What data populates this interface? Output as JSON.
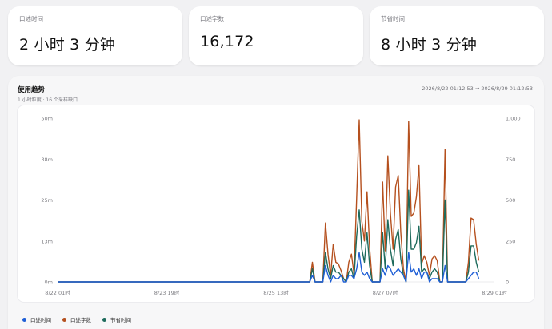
{
  "cards": [
    {
      "label": "口述时间",
      "value": "2 小时 3 分钟"
    },
    {
      "label": "口述字数",
      "value": "16,172"
    },
    {
      "label": "节省时间",
      "value": "8 小时 3 分钟"
    }
  ],
  "panel": {
    "title": "使用趋势",
    "subtitle": "1 小时粒度 · 16 个采样缺口",
    "range": "2026/8/22 01:12:53 → 2026/8/29 01:12:53"
  },
  "colors": {
    "dictation_time": "#1f5fd6",
    "word_count": "#b5501e",
    "saved_time": "#1e6b5c"
  },
  "chart_data": {
    "type": "line",
    "x_tick_labels": [
      "8/22 01时",
      "8/23 19时",
      "8/25 13时",
      "8/27 07时",
      "8/29 01时"
    ],
    "x_tick_positions": [
      0,
      42,
      84,
      126,
      168
    ],
    "x_range": [
      0,
      168
    ],
    "left_axis": {
      "ticks": [
        "0m",
        "13m",
        "25m",
        "38m",
        "50m"
      ],
      "ylim": [
        0,
        50
      ]
    },
    "right_axis": {
      "ticks": [
        "0",
        "250",
        "500",
        "750",
        "1,000"
      ],
      "ylim": [
        0,
        1000
      ]
    },
    "grid": false,
    "legend_position": "bottom-left",
    "series": [
      {
        "name": "口述时间",
        "axis": "left",
        "color": "#1f5fd6",
        "points": [
          [
            0,
            0
          ],
          [
            97,
            0
          ],
          [
            98,
            2
          ],
          [
            99,
            0
          ],
          [
            100,
            0
          ],
          [
            101,
            0
          ],
          [
            102,
            0
          ],
          [
            103,
            5
          ],
          [
            104,
            2
          ],
          [
            105,
            0
          ],
          [
            106,
            2
          ],
          [
            107,
            1
          ],
          [
            108,
            1
          ],
          [
            109,
            2
          ],
          [
            110,
            0
          ],
          [
            111,
            0
          ],
          [
            112,
            2
          ],
          [
            113,
            2
          ],
          [
            114,
            1
          ],
          [
            115,
            4
          ],
          [
            116,
            9
          ],
          [
            117,
            3
          ],
          [
            118,
            2
          ],
          [
            119,
            3
          ],
          [
            120,
            1
          ],
          [
            121,
            0
          ],
          [
            122,
            0
          ],
          [
            123,
            0
          ],
          [
            124,
            0
          ],
          [
            125,
            4
          ],
          [
            126,
            2
          ],
          [
            127,
            5
          ],
          [
            128,
            4
          ],
          [
            129,
            2
          ],
          [
            130,
            3
          ],
          [
            131,
            4
          ],
          [
            132,
            3
          ],
          [
            133,
            2
          ],
          [
            134,
            0
          ],
          [
            135,
            9
          ],
          [
            136,
            3
          ],
          [
            137,
            4
          ],
          [
            138,
            2
          ],
          [
            139,
            4
          ],
          [
            140,
            1
          ],
          [
            141,
            3
          ],
          [
            142,
            3
          ],
          [
            143,
            0
          ],
          [
            144,
            1
          ],
          [
            145,
            1
          ],
          [
            146,
            1
          ],
          [
            147,
            0
          ],
          [
            148,
            0
          ],
          [
            149,
            5
          ],
          [
            150,
            0
          ],
          [
            151,
            0
          ],
          [
            152,
            0
          ],
          [
            153,
            0
          ],
          [
            154,
            0
          ],
          [
            155,
            0
          ],
          [
            156,
            0
          ],
          [
            157,
            0
          ],
          [
            158,
            1
          ],
          [
            159,
            2
          ],
          [
            160,
            3
          ],
          [
            161,
            3
          ],
          [
            162,
            1
          ]
        ]
      },
      {
        "name": "口述字数",
        "axis": "right",
        "color": "#b5501e",
        "points": [
          [
            0,
            0
          ],
          [
            97,
            0
          ],
          [
            98,
            120
          ],
          [
            99,
            0
          ],
          [
            100,
            0
          ],
          [
            101,
            0
          ],
          [
            102,
            0
          ],
          [
            103,
            360
          ],
          [
            104,
            170
          ],
          [
            105,
            40
          ],
          [
            106,
            230
          ],
          [
            107,
            120
          ],
          [
            108,
            110
          ],
          [
            109,
            70
          ],
          [
            110,
            20
          ],
          [
            111,
            0
          ],
          [
            112,
            120
          ],
          [
            113,
            170
          ],
          [
            114,
            50
          ],
          [
            115,
            510
          ],
          [
            116,
            990
          ],
          [
            117,
            370
          ],
          [
            118,
            250
          ],
          [
            119,
            550
          ],
          [
            120,
            210
          ],
          [
            121,
            0
          ],
          [
            122,
            0
          ],
          [
            123,
            0
          ],
          [
            124,
            0
          ],
          [
            125,
            610
          ],
          [
            126,
            190
          ],
          [
            127,
            770
          ],
          [
            128,
            420
          ],
          [
            129,
            200
          ],
          [
            130,
            580
          ],
          [
            131,
            650
          ],
          [
            132,
            300
          ],
          [
            133,
            80
          ],
          [
            134,
            0
          ],
          [
            135,
            980
          ],
          [
            136,
            400
          ],
          [
            137,
            420
          ],
          [
            138,
            520
          ],
          [
            139,
            710
          ],
          [
            140,
            110
          ],
          [
            141,
            160
          ],
          [
            142,
            120
          ],
          [
            143,
            40
          ],
          [
            144,
            140
          ],
          [
            145,
            160
          ],
          [
            146,
            130
          ],
          [
            147,
            0
          ],
          [
            148,
            0
          ],
          [
            149,
            810
          ],
          [
            150,
            0
          ],
          [
            151,
            0
          ],
          [
            152,
            0
          ],
          [
            153,
            0
          ],
          [
            154,
            0
          ],
          [
            155,
            0
          ],
          [
            156,
            0
          ],
          [
            157,
            0
          ],
          [
            158,
            120
          ],
          [
            159,
            390
          ],
          [
            160,
            380
          ],
          [
            161,
            230
          ],
          [
            162,
            130
          ]
        ]
      },
      {
        "name": "节省时间",
        "axis": "left",
        "color": "#1e6b5c",
        "points": [
          [
            0,
            0
          ],
          [
            97,
            0
          ],
          [
            98,
            4
          ],
          [
            99,
            0
          ],
          [
            100,
            0
          ],
          [
            101,
            0
          ],
          [
            102,
            0
          ],
          [
            103,
            9
          ],
          [
            104,
            4
          ],
          [
            105,
            1
          ],
          [
            106,
            5
          ],
          [
            107,
            3
          ],
          [
            108,
            3
          ],
          [
            109,
            2
          ],
          [
            110,
            1
          ],
          [
            111,
            0
          ],
          [
            112,
            3
          ],
          [
            113,
            4
          ],
          [
            114,
            1
          ],
          [
            115,
            14
          ],
          [
            116,
            22
          ],
          [
            117,
            10
          ],
          [
            118,
            6
          ],
          [
            119,
            15
          ],
          [
            120,
            5
          ],
          [
            121,
            0
          ],
          [
            122,
            0
          ],
          [
            123,
            0
          ],
          [
            124,
            0
          ],
          [
            125,
            15
          ],
          [
            126,
            4
          ],
          [
            127,
            19
          ],
          [
            128,
            10
          ],
          [
            129,
            5
          ],
          [
            130,
            13
          ],
          [
            131,
            16
          ],
          [
            132,
            7
          ],
          [
            133,
            2
          ],
          [
            134,
            0
          ],
          [
            135,
            28
          ],
          [
            136,
            10
          ],
          [
            137,
            10
          ],
          [
            138,
            12
          ],
          [
            139,
            17
          ],
          [
            140,
            3
          ],
          [
            141,
            4
          ],
          [
            142,
            3
          ],
          [
            143,
            1
          ],
          [
            144,
            3
          ],
          [
            145,
            4
          ],
          [
            146,
            3
          ],
          [
            147,
            0
          ],
          [
            148,
            0
          ],
          [
            149,
            25
          ],
          [
            150,
            0
          ],
          [
            151,
            0
          ],
          [
            152,
            0
          ],
          [
            153,
            0
          ],
          [
            154,
            0
          ],
          [
            155,
            0
          ],
          [
            156,
            0
          ],
          [
            157,
            0
          ],
          [
            158,
            3
          ],
          [
            159,
            11
          ],
          [
            160,
            11
          ],
          [
            161,
            6
          ],
          [
            162,
            3
          ]
        ]
      }
    ]
  }
}
